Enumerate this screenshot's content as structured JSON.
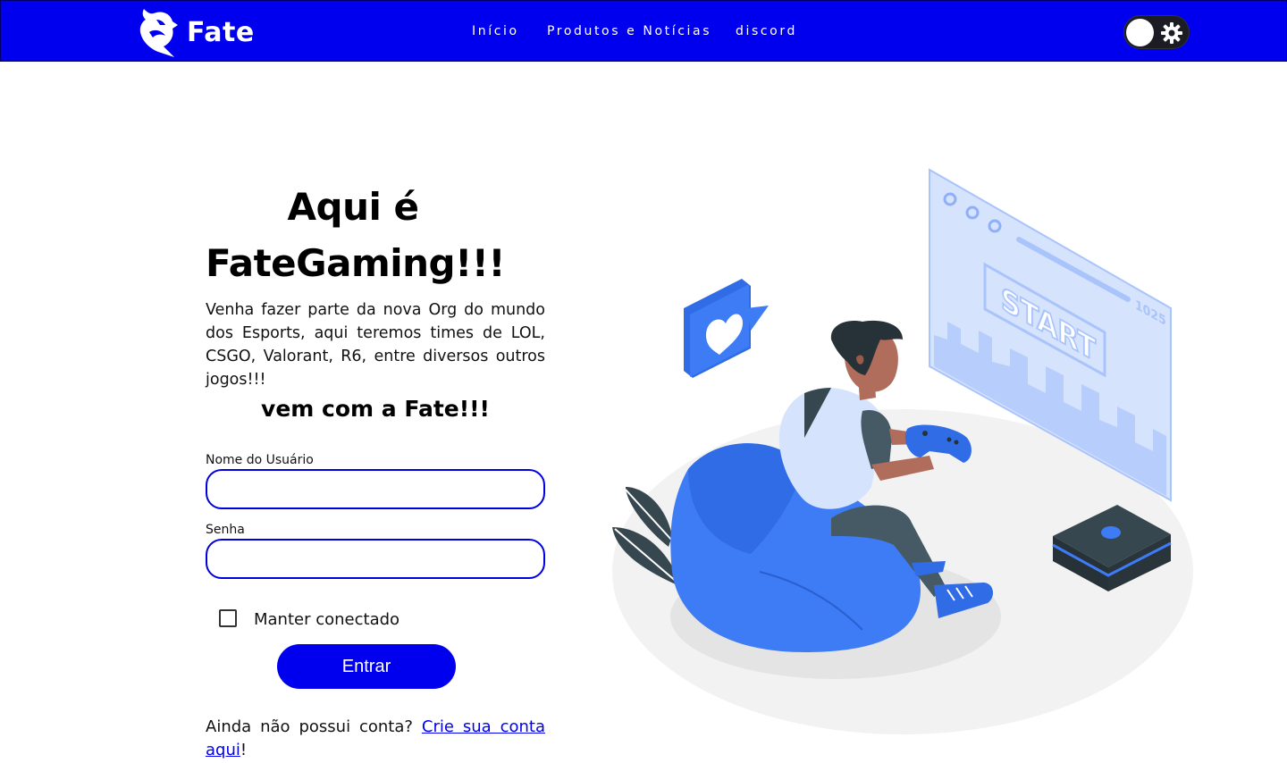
{
  "header": {
    "brand": "Fate",
    "nav": [
      {
        "label": "Início"
      },
      {
        "label": "Produtos e Notícias"
      },
      {
        "label": "discord"
      }
    ],
    "theme_toggle_icon": "gear-icon"
  },
  "hero": {
    "title": "Aqui é FateGaming!!!",
    "description": "Venha fazer parte da nova Org do mundo dos Esports, aqui teremos times de LOL, CSGO, Valorant, R6, entre diversos outros jogos!!!",
    "cta": "vem com a Fate!!!"
  },
  "form": {
    "username_label": "Nome do Usuário",
    "username_value": "",
    "password_label": "Senha",
    "password_value": "",
    "remember_label": "Manter conectado",
    "remember_checked": false,
    "submit_label": "Entrar",
    "signup_prompt": "Ainda não possui conta?",
    "signup_link": "Crie sua conta aqui",
    "signup_suffix": "!"
  },
  "illustration": {
    "screen_text": "START",
    "screen_counter": "1025"
  },
  "colors": {
    "primary": "#0000ee",
    "accent_blue": "#3d7cf5",
    "dark": "#37474f"
  }
}
